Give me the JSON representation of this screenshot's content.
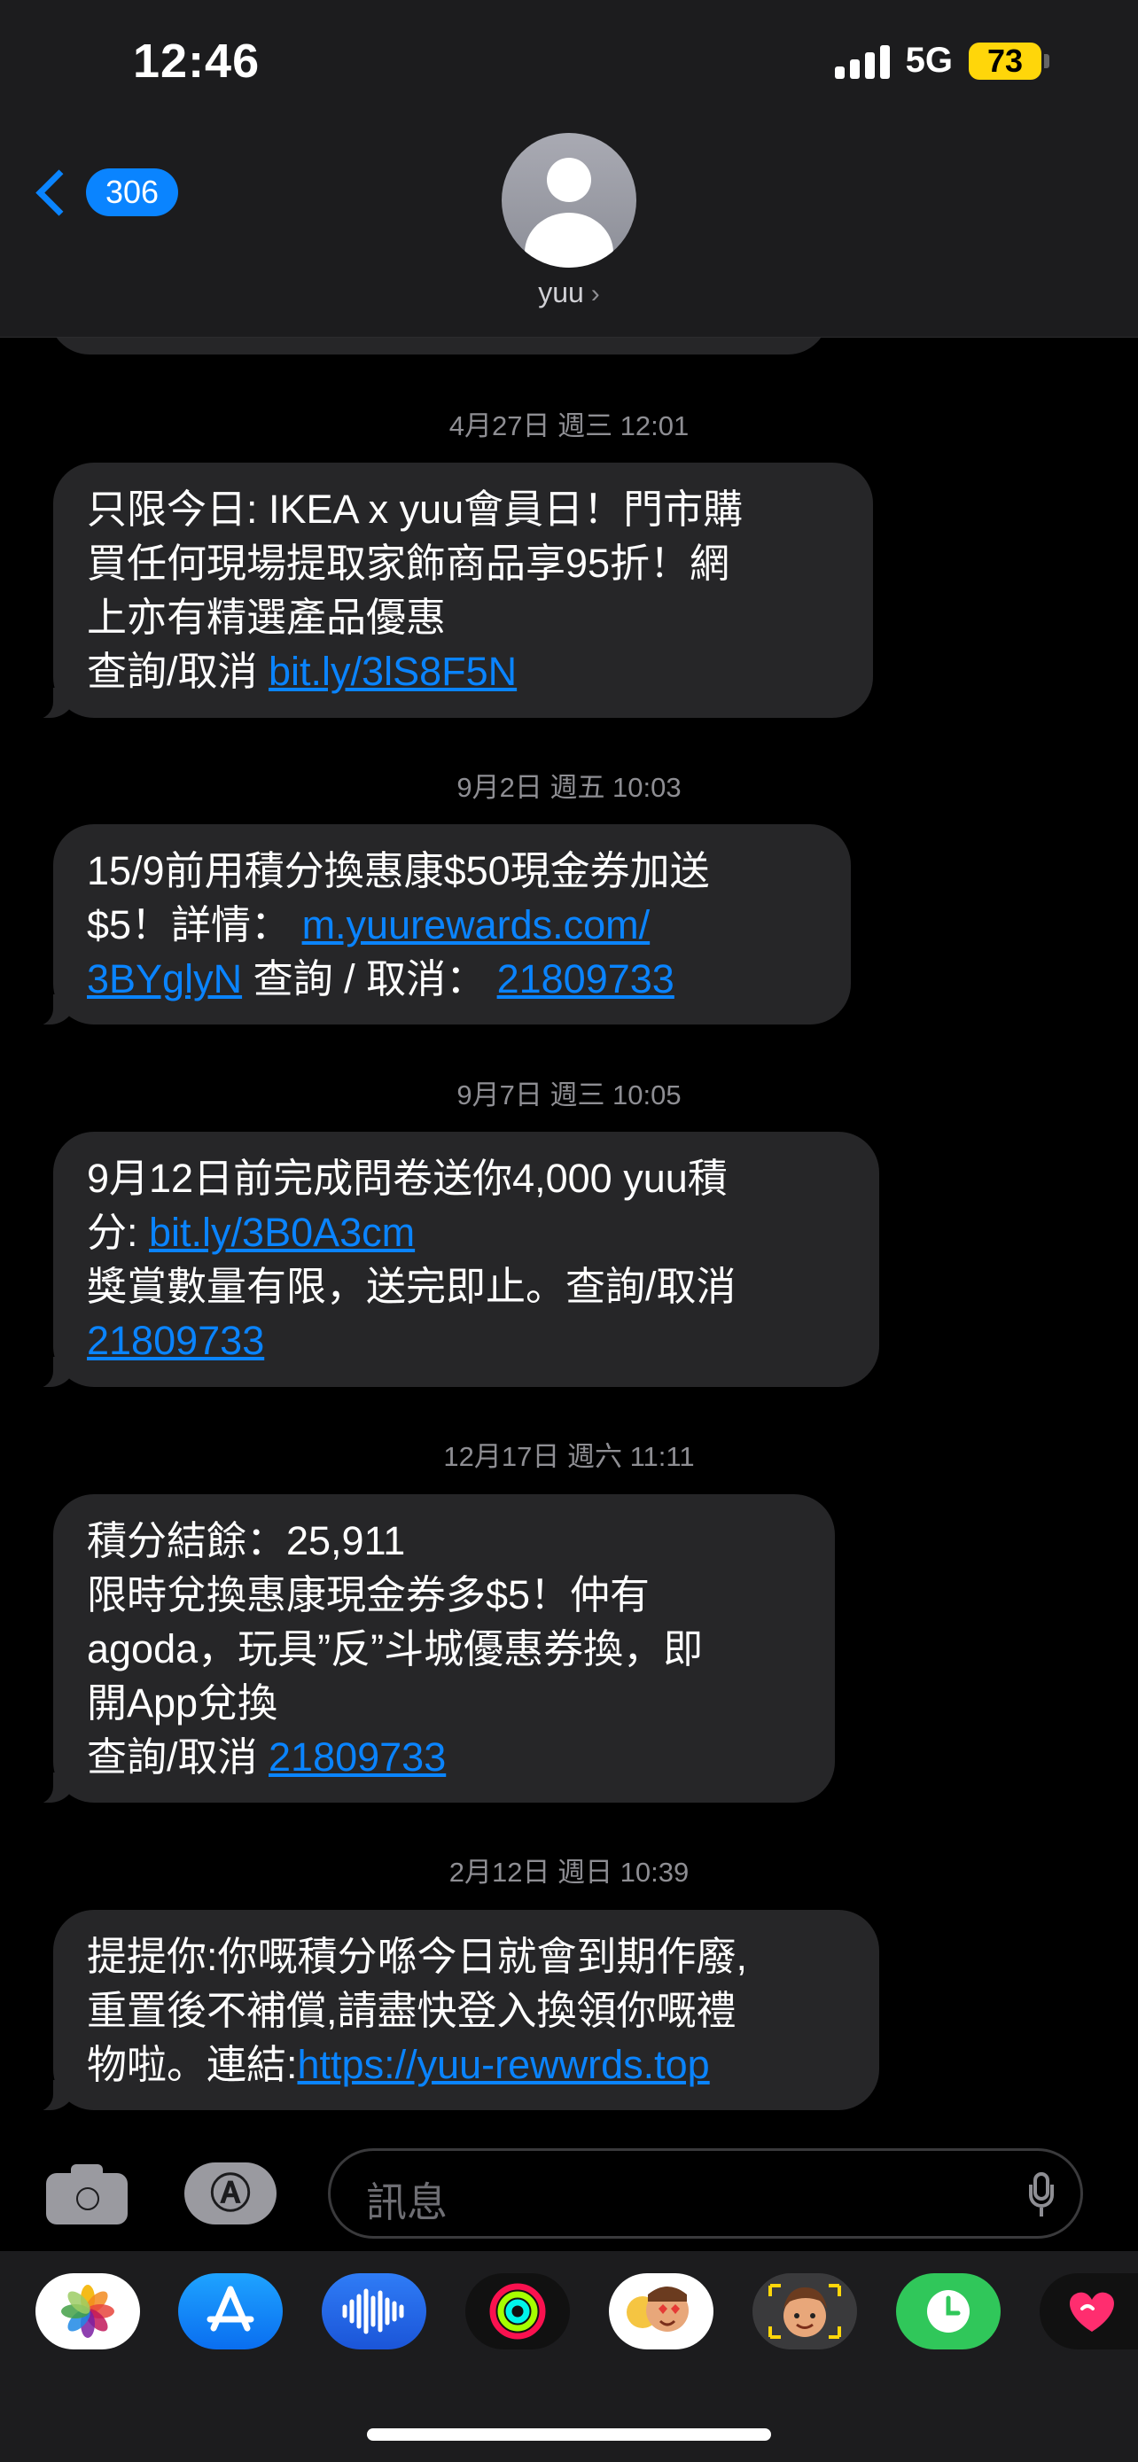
{
  "status_bar": {
    "time": "12:46",
    "network": "5G",
    "battery": "73"
  },
  "nav": {
    "back_count": "306",
    "contact_name": "yuu"
  },
  "messages": [
    {
      "timestamp": "4月27日 週三 12:01",
      "lines": [
        "只限今日: IKEA x yuu會員日！門市購",
        "買任何現場提取家飾商品享95折！網",
        "上亦有精選產品優惠"
      ],
      "last_prefix": "查詢/取消 ",
      "last_link": "bit.ly/3lS8F5N"
    },
    {
      "timestamp": "9月2日 週五 10:03",
      "line1": "15/9前用積分換惠康$50現金券加送",
      "line2_prefix": "$5！詳情： ",
      "line2_link": "m.yuurewards.com/",
      "line3_link": "3BYglyN",
      "line3_middle": " 查詢 / 取消： ",
      "line3_link2": "21809733"
    },
    {
      "timestamp": "9月7日 週三 10:05",
      "line1": "9月12日前完成問卷送你4,000 yuu積",
      "line2_prefix": "分: ",
      "line2_link": "bit.ly/3B0A3cm",
      "line3": "獎賞數量有限，送完即止。查詢/取消",
      "line4_link": "21809733"
    },
    {
      "timestamp": "12月17日 週六 11:11",
      "lines": [
        "積分結餘：25,911",
        "限時兌換惠康現金券多$5！仲有",
        "agoda，玩具”反”斗城優惠券換，即",
        "開App兌換"
      ],
      "last_prefix": "查詢/取消 ",
      "last_link": "21809733"
    },
    {
      "timestamp": "2月12日 週日 10:39",
      "lines": [
        "提提你:你嘅積分喺今日就會到期作廢,",
        "重置後不補償,請盡快登入換領你嘅禮"
      ],
      "last_prefix": "物啦。連結:",
      "last_link": "https://yuu-rewwrds.top"
    }
  ],
  "composer": {
    "placeholder": "訊息"
  },
  "apps_glyph": "Ⓐ",
  "app_drawer": [
    "photos-app",
    "app-store-app",
    "audio-message-app",
    "activity-app",
    "memoji-stickers-app",
    "memoji-app",
    "find-my-app",
    "digital-touch-app"
  ]
}
